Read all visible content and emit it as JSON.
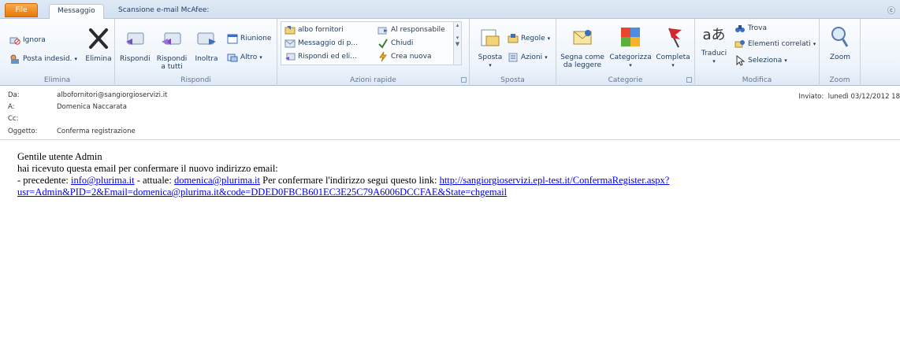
{
  "tabs": {
    "file": "File",
    "messaggio": "Messaggio",
    "mcafee": "Scansione e-mail McAfee:"
  },
  "ribbon": {
    "elimina_group": {
      "ignora": "Ignora",
      "posta_indesid": "Posta indesid.",
      "elimina": "Elimina",
      "label": "Elimina"
    },
    "rispondi_group": {
      "rispondi": "Rispondi",
      "rispondi_tutti_1": "Rispondi",
      "rispondi_tutti_2": "a tutti",
      "inoltra": "Inoltra",
      "riunione": "Riunione",
      "altro": "Altro",
      "label": "Rispondi"
    },
    "azioni_rapide": {
      "albo_fornitori": "albo fornitori",
      "messaggio_di_p": "Messaggio di p...",
      "rispondi_ed_eli": "Rispondi ed eli...",
      "al_responsabile": "Al responsabile",
      "chiudi": "Chiudi",
      "crea_nuova": "Crea nuova",
      "label": "Azioni rapide"
    },
    "sposta_group": {
      "sposta": "Sposta",
      "regole": "Regole",
      "azioni": "Azioni",
      "label": "Sposta"
    },
    "categorie_group": {
      "segna_come_1": "Segna come",
      "segna_come_2": "da leggere",
      "categorizza": "Categorizza",
      "completa": "Completa",
      "label": "Categorie"
    },
    "modifica_group": {
      "traduci": "Traduci",
      "trova": "Trova",
      "elementi_correlati": "Elementi correlati",
      "seleziona": "Seleziona",
      "label": "Modifica"
    },
    "zoom_group": {
      "zoom": "Zoom",
      "label": "Zoom"
    }
  },
  "header": {
    "da_label": "Da:",
    "da_value": "albofornitori@sangiorgioservizi.it",
    "a_label": "A:",
    "a_value": "Domenica Naccarata",
    "cc_label": "Cc:",
    "cc_value": "",
    "oggetto_label": "Oggetto:",
    "oggetto_value": "Conferma registrazione",
    "inviato_label": "Inviato:",
    "inviato_value": "lunedì 03/12/2012 18"
  },
  "body": {
    "greeting": "Gentile utente Admin",
    "line2": "hai ricevuto questa email per confermare il nuovo indirizzo email:",
    "prefix_prev": "- precedente: ",
    "prev_email": "info@plurima.it",
    "mid_actual": " - attuale: ",
    "actual_email": "domenica@plurima.it",
    "confirm_text": " Per confermare l'indirizzo segui questo link: ",
    "link_1": "http://sangiorgioservizi.epl-test.it/ConfermaRegister.aspx?",
    "link_2": "usr=Admin&PID=2&Email=domenica@plurima.it&code=DDED0FBCB601EC3E25C79A6006DCCFAE&State=chgemail"
  },
  "colors": {
    "file_tab": "#e8780a",
    "link": "#0000ee",
    "ribbon_text": "#1e395b"
  }
}
